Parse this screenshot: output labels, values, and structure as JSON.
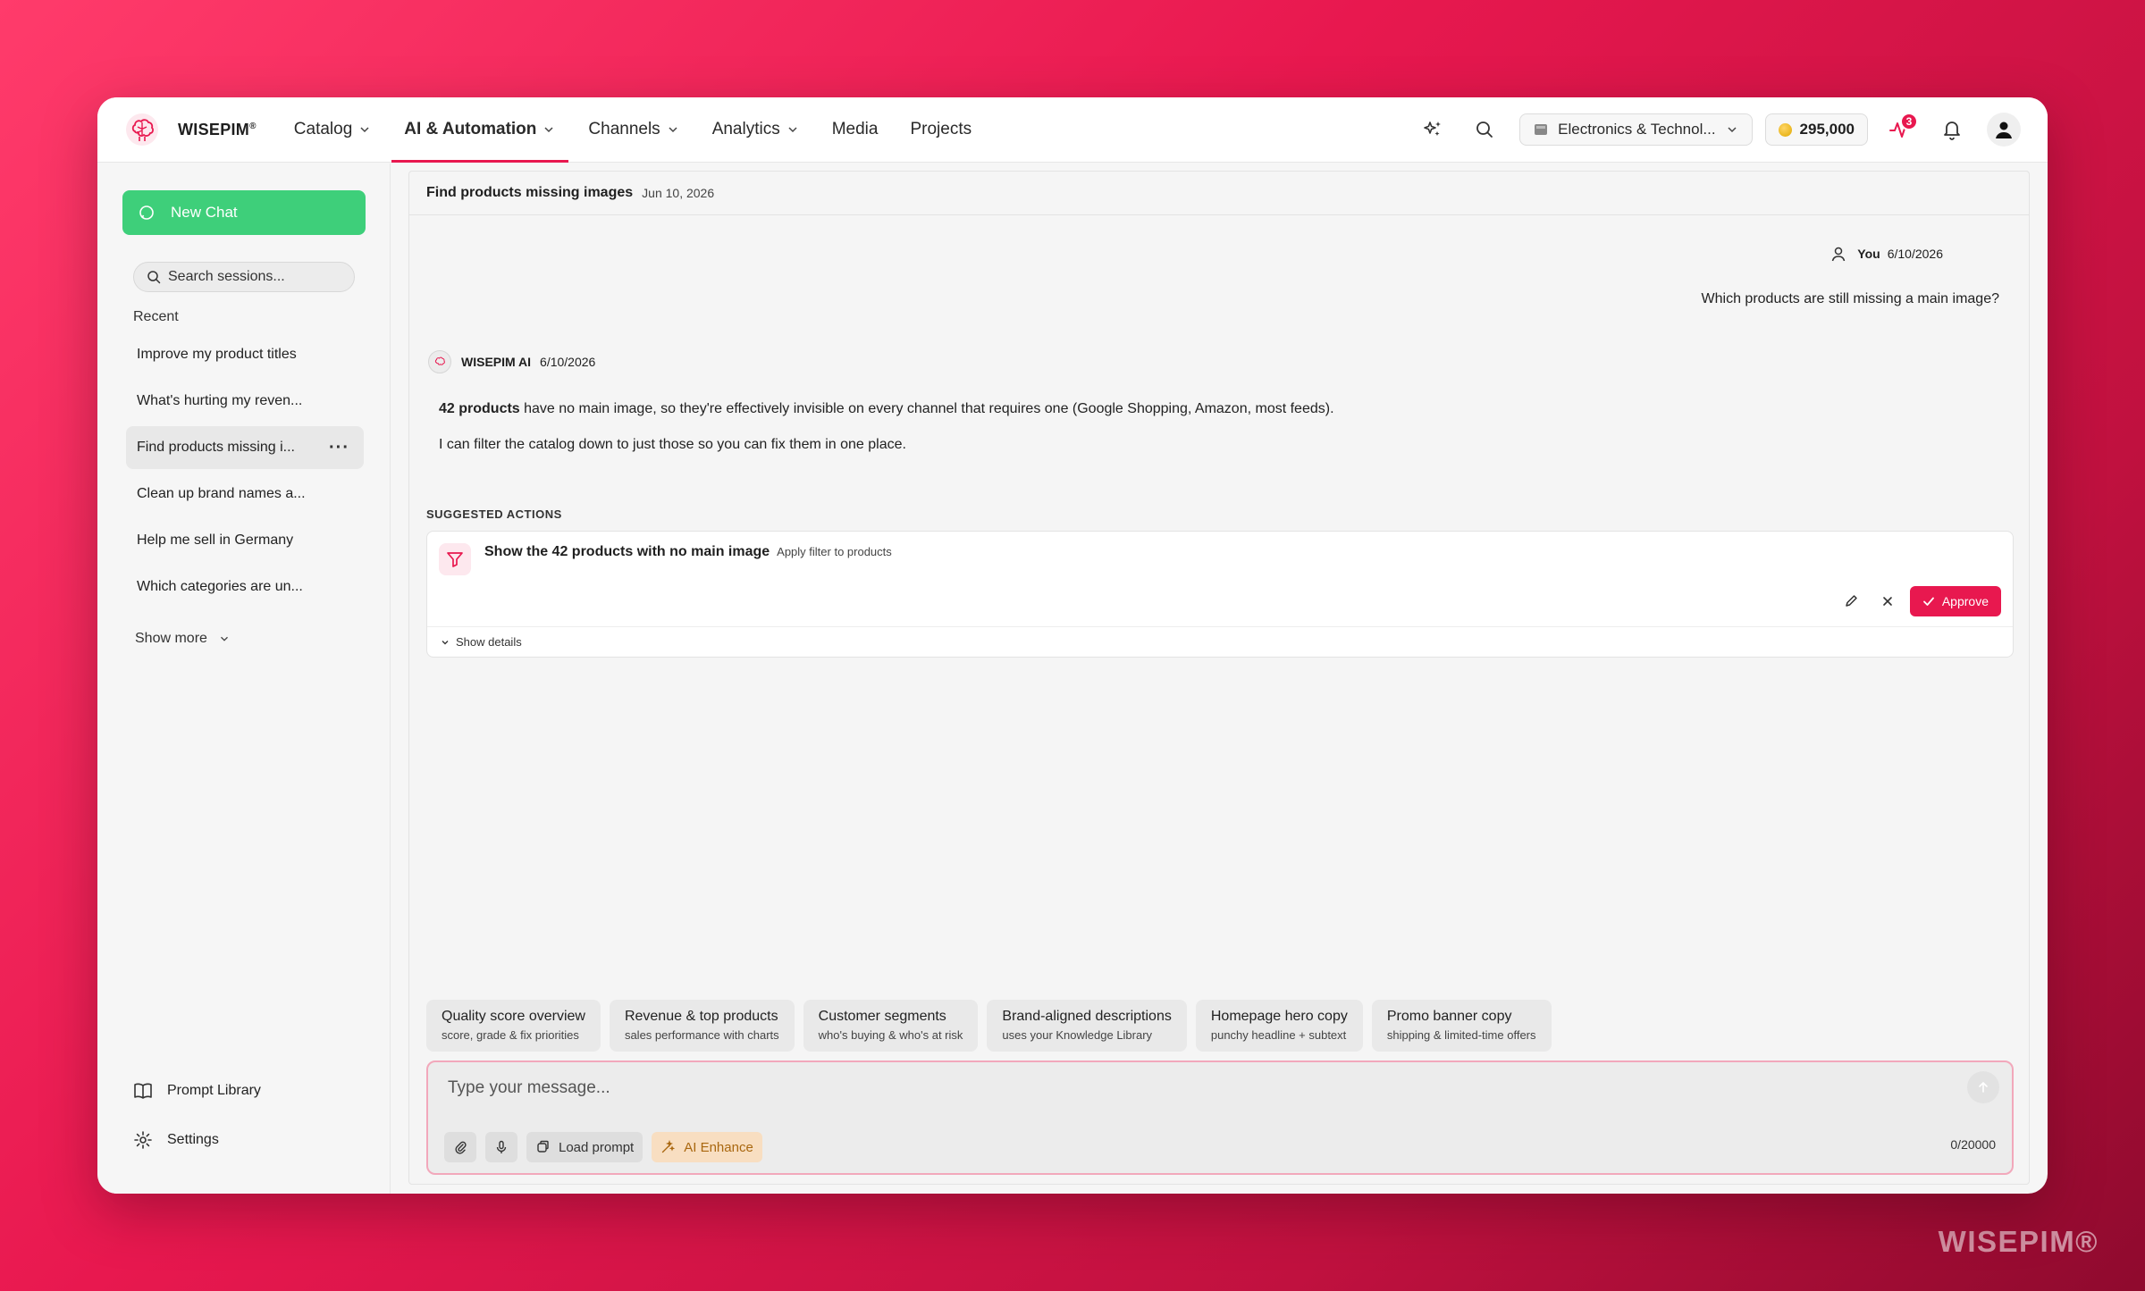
{
  "brand": {
    "name": "WISEPIM",
    "mark": "®"
  },
  "nav": [
    {
      "label": "Catalog",
      "dropdown": true,
      "active": false
    },
    {
      "label": "AI & Automation",
      "dropdown": true,
      "active": true
    },
    {
      "label": "Channels",
      "dropdown": true,
      "active": false
    },
    {
      "label": "Analytics",
      "dropdown": true,
      "active": false
    },
    {
      "label": "Media",
      "dropdown": false,
      "active": false
    },
    {
      "label": "Projects",
      "dropdown": false,
      "active": false
    }
  ],
  "topbar": {
    "store": "Electronics & Technol...",
    "credits": "295,000",
    "activity_badge": "3"
  },
  "sidebar": {
    "new_chat": "New Chat",
    "search_placeholder": "Search sessions...",
    "recent_label": "Recent",
    "sessions": [
      {
        "title": "Improve my product titles",
        "active": false
      },
      {
        "title": "What's hurting my reven...",
        "active": false
      },
      {
        "title": "Find products missing i...",
        "active": true
      },
      {
        "title": "Clean up brand names a...",
        "active": false
      },
      {
        "title": "Help me sell in Germany",
        "active": false
      },
      {
        "title": "Which categories are un...",
        "active": false
      }
    ],
    "show_more": "Show more",
    "prompt_library": "Prompt Library",
    "settings": "Settings"
  },
  "chat": {
    "title": "Find products missing images",
    "date": "Jun 10, 2026",
    "user": {
      "name": "You",
      "date": "6/10/2026",
      "message": "Which products are still missing a main image?"
    },
    "ai": {
      "name": "WISEPIM AI",
      "date": "6/10/2026",
      "p1_bold": "42 products",
      "p1_rest": " have no main image, so they're effectively invisible on every channel that requires one (Google Shopping, Amazon, most feeds).",
      "p2": "I can filter the catalog down to just those so you can fix them in one place."
    },
    "suggested_label": "SUGGESTED ACTIONS",
    "action": {
      "title": "Show the 42 products with no main image",
      "subtitle": "Apply filter to products",
      "approve": "Approve",
      "details": "Show details"
    },
    "chips": [
      {
        "title": "Quality score overview",
        "sub": "score, grade & fix priorities"
      },
      {
        "title": "Revenue & top products",
        "sub": "sales performance with charts"
      },
      {
        "title": "Customer segments",
        "sub": "who's buying & who's at risk"
      },
      {
        "title": "Brand-aligned descriptions",
        "sub": "uses your Knowledge Library"
      },
      {
        "title": "Homepage hero copy",
        "sub": "punchy headline + subtext"
      },
      {
        "title": "Promo banner copy",
        "sub": "shipping & limited-time offers"
      }
    ],
    "composer": {
      "placeholder": "Type your message...",
      "load_prompt": "Load prompt",
      "ai_enhance": "AI Enhance",
      "counter": "0/20000"
    }
  },
  "watermark": "WISEPIM®",
  "colors": {
    "accent": "#e8184f",
    "new_chat": "#3ecf7a",
    "enhance_bg": "#f8dec1"
  }
}
